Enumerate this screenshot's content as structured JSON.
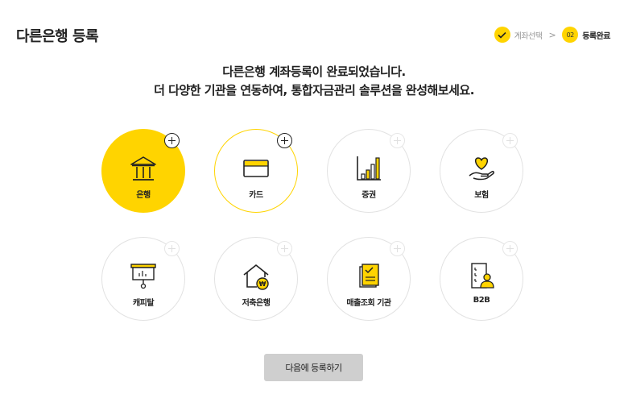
{
  "header": {
    "title": "다른은행 등록"
  },
  "steps": {
    "step1_label": "계좌선택",
    "step2_num": "02",
    "step2_label": "등록완료"
  },
  "message": {
    "line1": "다른은행 계좌등록이 완료되었습니다.",
    "line2": "더 다양한 기관을 연동하여, 통합자금관리 솔루션을 완성해보세요."
  },
  "tiles": [
    {
      "label": "은행",
      "icon": "bank-icon"
    },
    {
      "label": "카드",
      "icon": "card-icon"
    },
    {
      "label": "증권",
      "icon": "stock-chart-icon"
    },
    {
      "label": "보험",
      "icon": "heart-hand-icon"
    },
    {
      "label": "캐피탈",
      "icon": "presentation-board-icon"
    },
    {
      "label": "저축은행",
      "icon": "house-coin-icon"
    },
    {
      "label": "매출조회 기관",
      "icon": "document-check-icon"
    },
    {
      "label": "B2B",
      "icon": "building-person-icon"
    }
  ],
  "footer": {
    "next_label": "다음에 등록하기"
  },
  "colors": {
    "accent": "#ffd400",
    "button_bg": "#cfcfcf"
  }
}
